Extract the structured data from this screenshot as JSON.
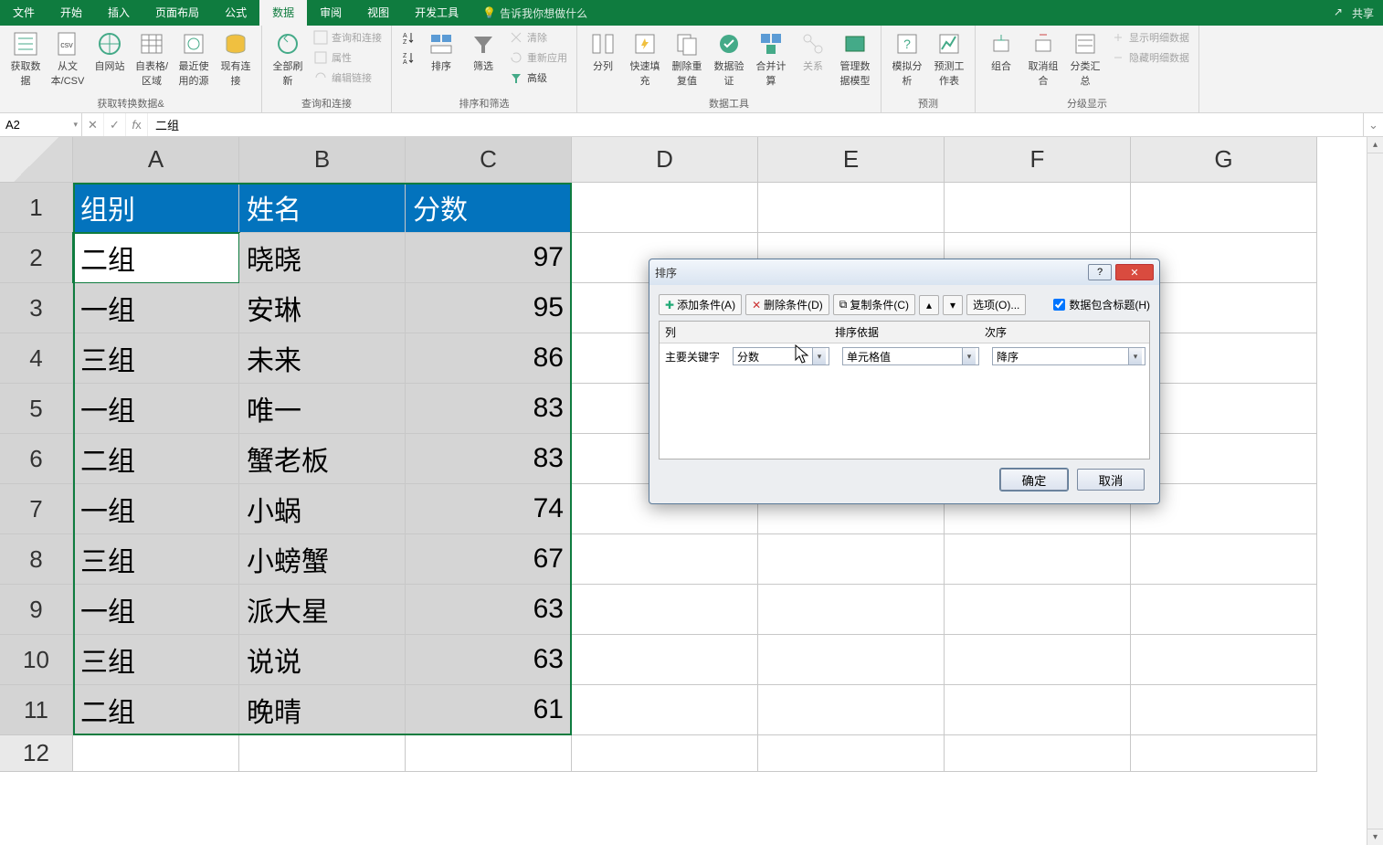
{
  "title_tabs": [
    "文件",
    "开始",
    "插入",
    "页面布局",
    "公式",
    "数据",
    "审阅",
    "视图",
    "开发工具"
  ],
  "active_tab_index": 5,
  "tellme": "告诉我你想做什么",
  "share": "共享",
  "ribbon": {
    "group1": {
      "label": "获取转换数据&",
      "items": [
        "获取数据",
        "从文本/CSV",
        "自网站",
        "自表格/区域",
        "最近使用的源",
        "现有连接"
      ]
    },
    "group2": {
      "label": "查询和连接",
      "big": "全部刷新",
      "small": [
        "查询和连接",
        "属性",
        "编辑链接"
      ]
    },
    "group3": {
      "label": "排序和筛选",
      "sort": "排序",
      "filter": "筛选",
      "small": [
        "清除",
        "重新应用",
        "高级"
      ]
    },
    "group4": {
      "label": "数据工具",
      "items": [
        "分列",
        "快速填充",
        "删除重复值",
        "数据验证",
        "合并计算",
        "关系",
        "管理数据模型"
      ]
    },
    "group5": {
      "label": "预测",
      "items": [
        "模拟分析",
        "预测工作表"
      ]
    },
    "group6": {
      "label": "分级显示",
      "items": [
        "组合",
        "取消组合",
        "分类汇总"
      ],
      "small": [
        "显示明细数据",
        "隐藏明细数据"
      ]
    }
  },
  "namebox": "A2",
  "formula": "二组",
  "colheads": [
    "A",
    "B",
    "C",
    "D",
    "E",
    "F",
    "G"
  ],
  "table": {
    "headers": [
      "组别",
      "姓名",
      "分数"
    ],
    "rows": [
      [
        "二组",
        "晓晓",
        "97"
      ],
      [
        "一组",
        "安琳",
        "95"
      ],
      [
        "三组",
        "未来",
        "86"
      ],
      [
        "一组",
        "唯一",
        "83"
      ],
      [
        "二组",
        "蟹老板",
        "83"
      ],
      [
        "一组",
        "小蜗",
        "74"
      ],
      [
        "三组",
        "小螃蟹",
        "67"
      ],
      [
        "一组",
        "派大星",
        "63"
      ],
      [
        "三组",
        "说说",
        "63"
      ],
      [
        "二组",
        "晚晴",
        "61"
      ]
    ]
  },
  "dialog": {
    "title": "排序",
    "add": "添加条件(A)",
    "del": "删除条件(D)",
    "copy": "复制条件(C)",
    "options": "选项(O)...",
    "headers_chk": "数据包含标题(H)",
    "col_header": "列",
    "sort_on_header": "排序依据",
    "order_header": "次序",
    "primary_label": "主要关键字",
    "column_value": "分数",
    "sort_on_value": "单元格值",
    "order_value": "降序",
    "ok": "确定",
    "cancel": "取消"
  }
}
